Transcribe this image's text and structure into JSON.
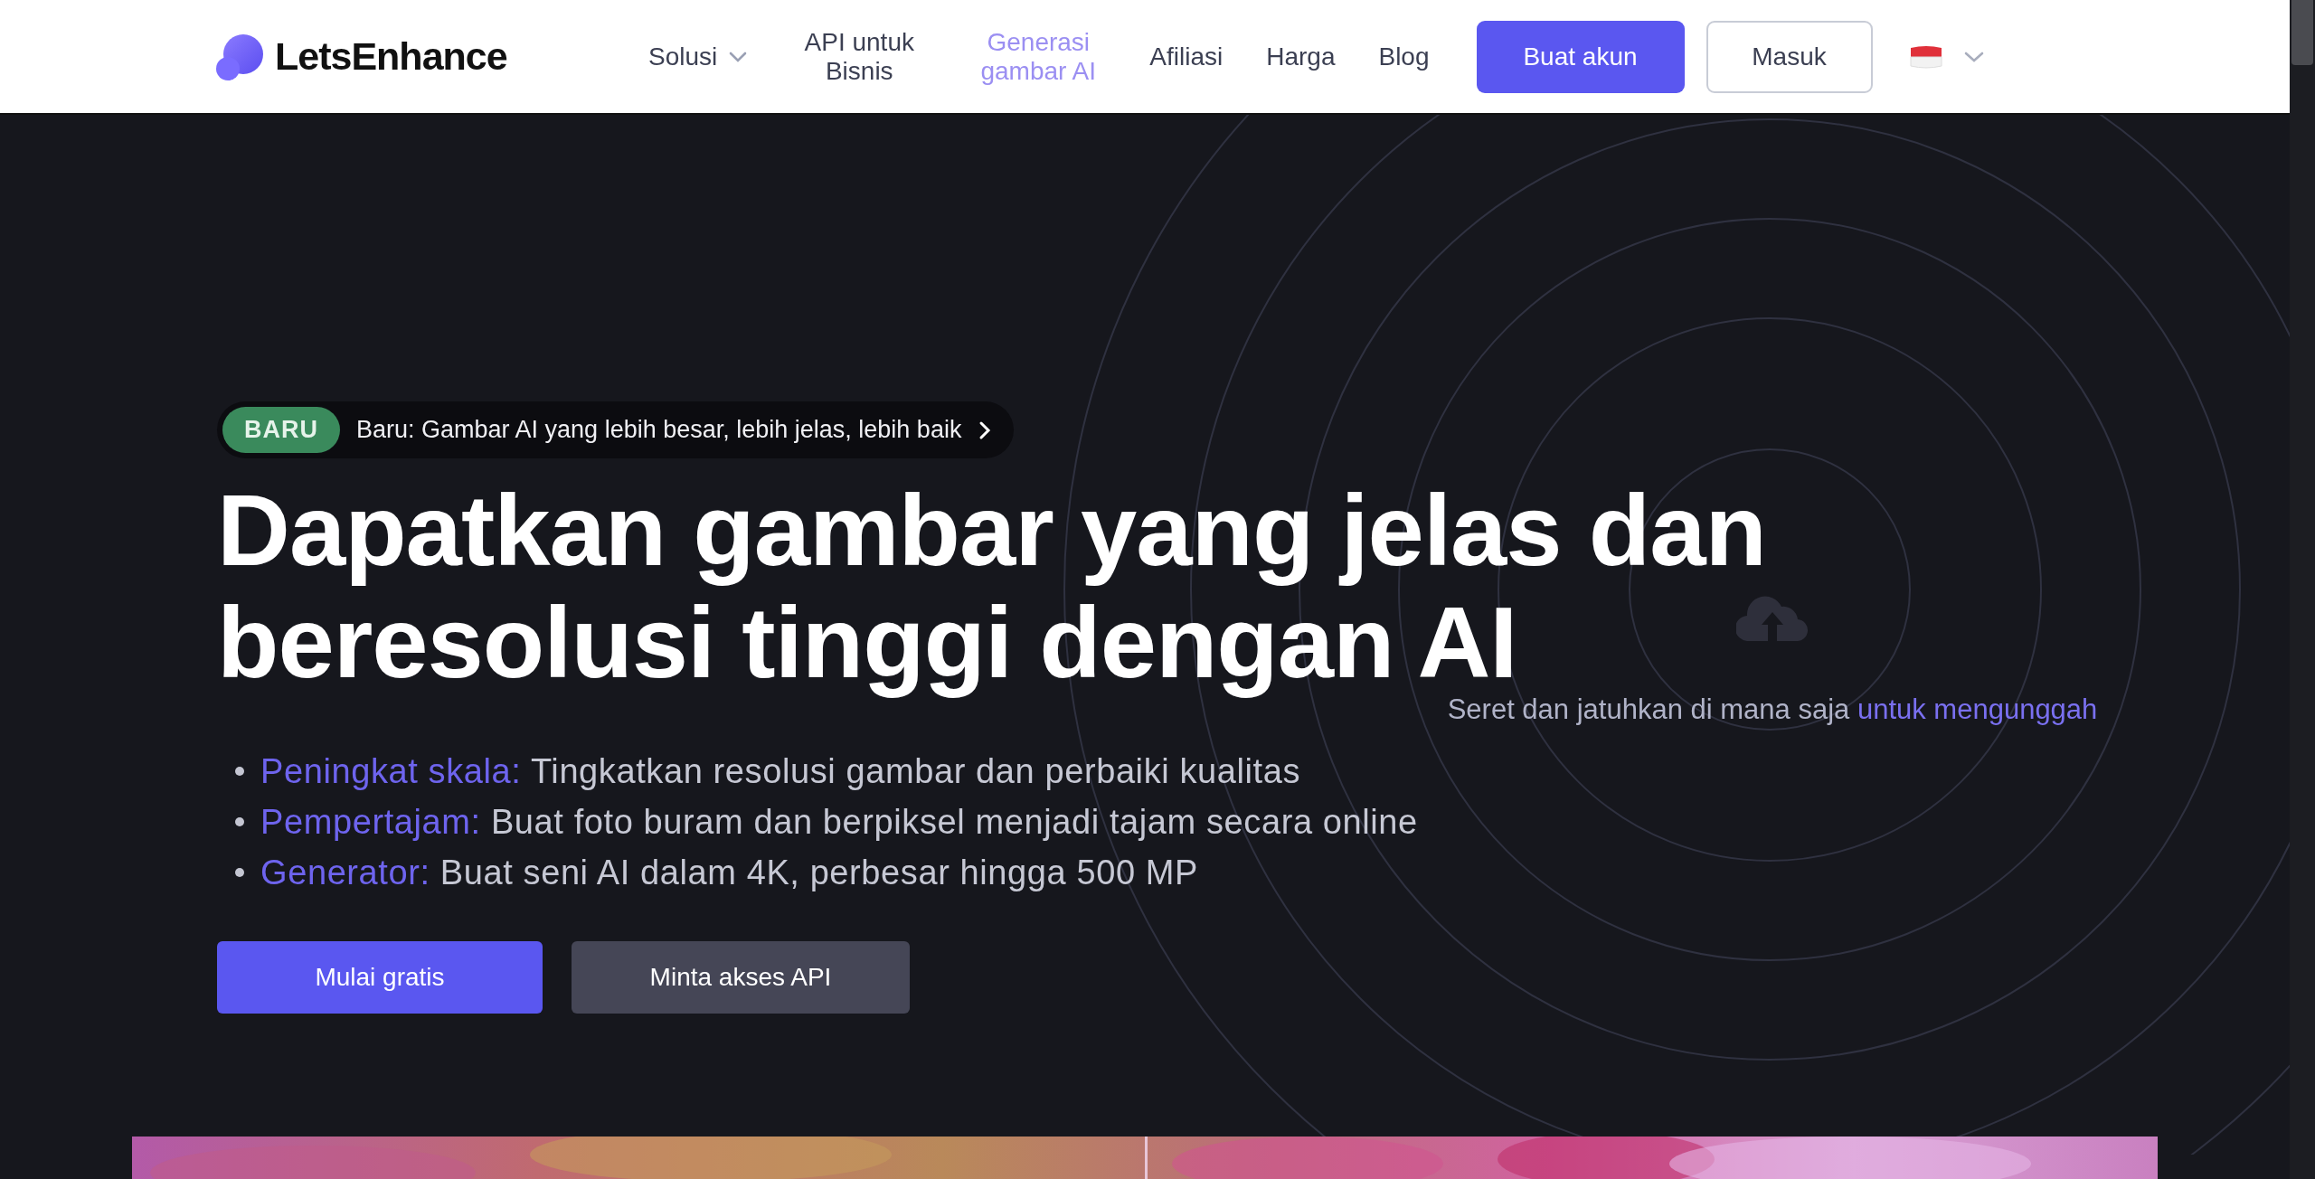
{
  "header": {
    "logo": "LetsEnhance",
    "nav": [
      {
        "label": "Solusi",
        "selected": false,
        "kind": "dropdown"
      },
      {
        "label": "API untuk Bisnis",
        "selected": false,
        "kind": "link"
      },
      {
        "label": "Generasi gambar AI",
        "selected": true,
        "kind": "link"
      },
      {
        "label": "Afiliasi",
        "selected": false,
        "kind": "link"
      },
      {
        "label": "Harga",
        "selected": false,
        "kind": "link"
      },
      {
        "label": "Blog",
        "selected": false,
        "kind": "link"
      }
    ],
    "signup_button": "Buat akun",
    "login_button": "Masuk"
  },
  "hero": {
    "badge": "BARU",
    "announcement": "Baru: Gambar AI yang lebih besar, lebih jelas, lebih baik",
    "heading": [
      "Dapatkan gambar yang jelas dan",
      "beresolusi tinggi dengan AI"
    ],
    "features": [
      {
        "label": "Peningkat skala:",
        "text": "Tingkatkan resolusi gambar dan perbaiki kualitas"
      },
      {
        "label": "Pempertajam:",
        "text": "Buat foto buram dan berpiksel menjadi tajam secara online"
      },
      {
        "label": "Generator:",
        "text": "Buat seni AI dalam 4K, perbesar hingga 500 MP"
      }
    ],
    "primary_button": "Mulai gratis",
    "secondary_button": "Minta akses API"
  },
  "upload": {
    "hint": "Seret dan jatuhkan di mana saja",
    "link": "untuk mengunggah"
  }
}
